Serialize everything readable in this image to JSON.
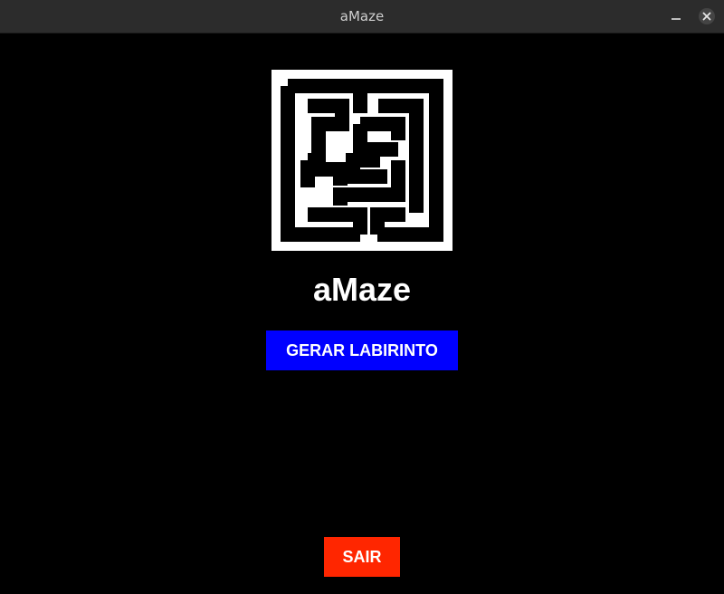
{
  "window": {
    "title": "aMaze"
  },
  "main": {
    "app_title": "aMaze",
    "logo_icon": "maze-logo-icon",
    "generate_button_label": "GERAR LABIRINTO",
    "exit_button_label": "SAIR"
  },
  "colors": {
    "background": "#000000",
    "generate_button": "#0000ff",
    "exit_button": "#ff2600",
    "titlebar": "#2c2c2c"
  }
}
